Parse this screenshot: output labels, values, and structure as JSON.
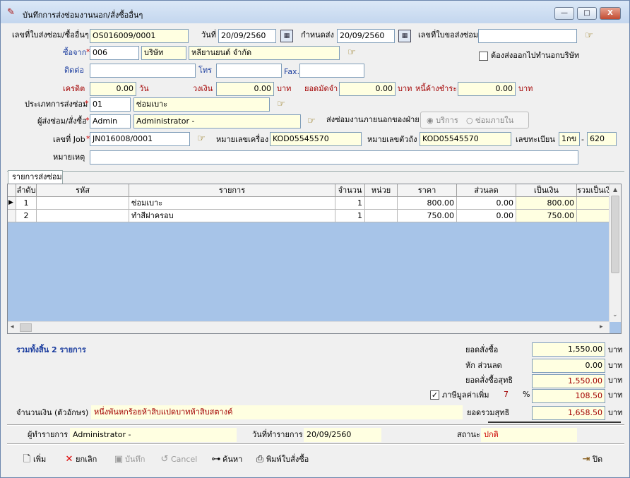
{
  "window": {
    "title": "บันทึกการส่งซ่อมงานนอก/สั่งซื้ออื่นๆ",
    "min": "—",
    "max": "□",
    "close": "X"
  },
  "header": {
    "doc_no_label": "เลขที่ใบส่งซ่อม/ซื้ออื่นๆ",
    "doc_no": "OS016009/0001",
    "date_label": "วันที่",
    "date": "20/09/2560",
    "due_label": "กำหนดส่ง",
    "due": "20/09/2560",
    "req_no_label": "เลขที่ใบขอส่งซ่อม",
    "req_no": "",
    "buy_from_label": "ซื้อจาก",
    "vendor_code": "006",
    "vendor_type": "บริษัท",
    "vendor_name": "หลียานยนต์ จำกัด",
    "outside_label": "ต้องส่งออกไปทำนอกบริษัท",
    "contact_label": "ติดต่อ",
    "contact": "",
    "tel_label": "โทร",
    "tel": "",
    "fax_label": "Fax.",
    "fax": "",
    "credit_label": "เครดิต",
    "credit": "0.00",
    "day_unit": "วัน",
    "limit_label": "วงเงิน",
    "limit": "0.00",
    "baht": "บาท",
    "deposit_label": "ยอดมัดจำ",
    "deposit": "0.00",
    "outstanding_label": "หนี้ค้างชำระ",
    "outstanding": "0.00",
    "type_label": "ประเภทการส่งซ่อม",
    "type_code": "01",
    "type_name": "ซ่อมเบาะ",
    "sender_label": "ผู้ส่งซ่อม/สั่งซื้อ",
    "sender_code": "Admin",
    "sender_name": "Administrator -",
    "outside_dept_label": "ส่งซ่อมงานภายนอกของฝ่าย",
    "radio_service": "บริการ",
    "radio_internal": "ซ่อมภายใน",
    "job_label": "เลขที่ Job",
    "job_no": "JN016008/0001",
    "engine_label": "หมายเลขเครื่อง",
    "engine_no": "KOD05545570",
    "chassis_label": "หมายเลขตัวถัง",
    "chassis_no": "KOD05545570",
    "plate_label": "เลขทะเบียน",
    "plate_prefix": "1กข",
    "plate_dash": "-",
    "plate_no": "620",
    "remark_label": "หมายเหตุ",
    "remark": ""
  },
  "tab": {
    "label": "รายการส่งซ่อม"
  },
  "table": {
    "columns": [
      "ลำดับ",
      "รหัส",
      "รายการ",
      "จำนวน",
      "หน่วย",
      "ราคา",
      "ส่วนลด",
      "เป็นเงิน",
      "รวมเป็นเงิน"
    ],
    "row_marker": "▶",
    "rows": [
      {
        "no": "1",
        "code": "",
        "item": "ซ่อมเบาะ",
        "qty": "1",
        "unit": "",
        "price": "800.00",
        "discount": "0.00",
        "amount": "800.00",
        "total": ""
      },
      {
        "no": "2",
        "code": "",
        "item": "ทำสีฝาครอบ",
        "qty": "1",
        "unit": "",
        "price": "750.00",
        "discount": "0.00",
        "amount": "750.00",
        "total": ""
      }
    ]
  },
  "summary": {
    "count_text": "รวมทั้งสิ้น 2 รายการ",
    "order_label": "ยอดสั่งซื้อ",
    "order": "1,550.00",
    "discount_label": "หัก ส่วนลด",
    "discount": "0.00",
    "net_label": "ยอดสั่งซื้อสุทธิ",
    "net": "1,550.00",
    "vat_label": "ภาษีมูลค่าเพิ่ม",
    "vat_rate": "7",
    "pct": "%",
    "vat": "108.50",
    "grand_label": "ยอดรวมสุทธิ",
    "grand": "1,658.50",
    "baht": "บาท",
    "words_label": "จำนวนเงิน (ตัวอักษร)",
    "words": "หนึ่งพันหกร้อยห้าสิบแปดบาทห้าสิบสตางค์"
  },
  "status": {
    "user_label": "ผู้ทำรายการ",
    "user": "Administrator -",
    "date_label": "วันที่ทำรายการ",
    "date": "20/09/2560",
    "state_label": "สถานะ",
    "state": "ปกติ"
  },
  "toolbar": {
    "add": "เพิ่ม",
    "cancel_doc": "ยกเลิก",
    "save": "บันทึก",
    "cancel": "Cancel",
    "search": "ค้นหา",
    "print": "พิมพ์ใบสั่งซื้อ",
    "close": "ปิด"
  },
  "colors": {
    "required": "#cc0000",
    "label_red": "#a30000",
    "label_blue": "#1a3c9e",
    "yellow_field": "#ffffe1",
    "grid_bg": "#a7c4e8"
  }
}
